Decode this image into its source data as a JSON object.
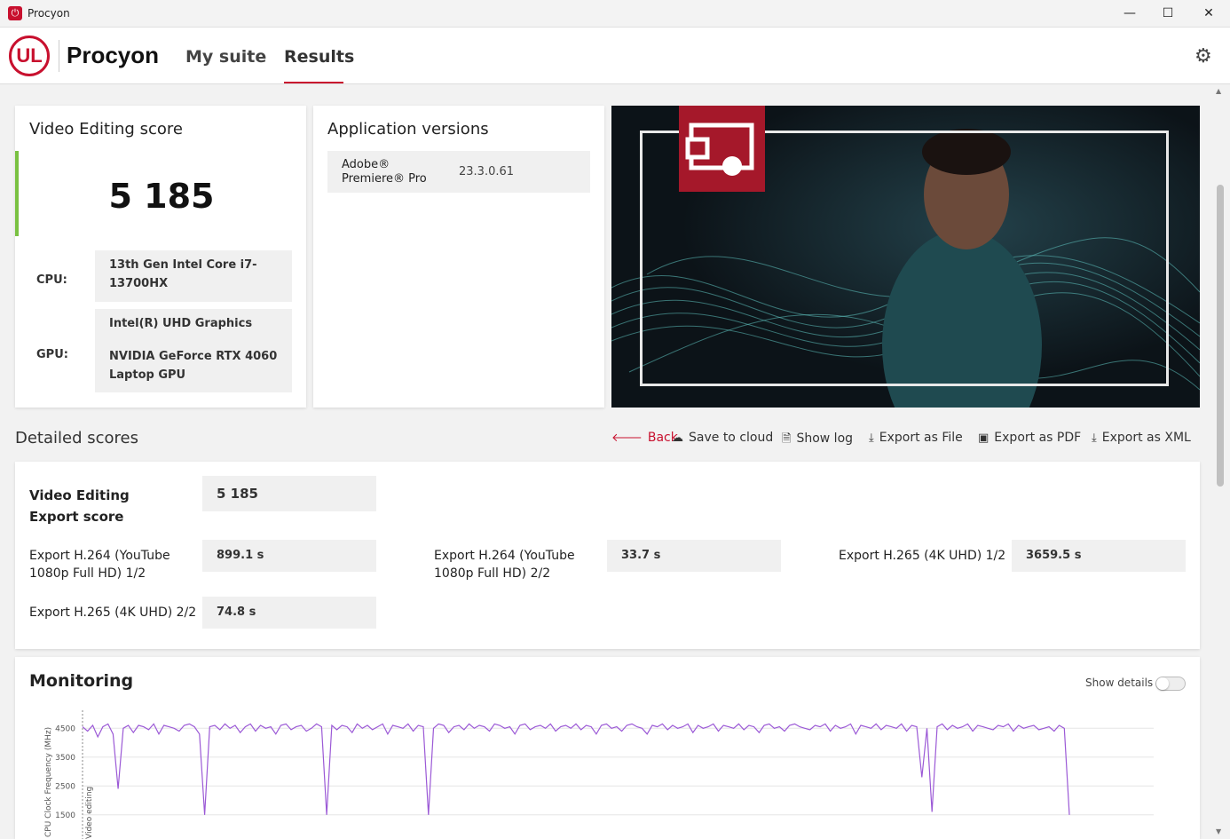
{
  "window": {
    "title": "Procyon",
    "minimize": "—",
    "maximize": "☐",
    "close": "✕"
  },
  "header": {
    "logo": "UL",
    "brand": "Procyon",
    "nav": [
      {
        "label": "My suite",
        "active": false
      },
      {
        "label": "Results",
        "active": true
      }
    ],
    "settings_icon": "gear-icon"
  },
  "score_card": {
    "title": "Video Editing score",
    "score": "5 185",
    "accent_color": "#7ac142",
    "cpu_label": "CPU:",
    "cpu_value": "13th Gen Intel Core i7-13700HX",
    "gpu_label": "GPU:",
    "gpu_value_1": "Intel(R) UHD Graphics",
    "gpu_value_2": "NVIDIA GeForce RTX 4060 Laptop GPU"
  },
  "app_versions": {
    "title": "Application versions",
    "rows": [
      {
        "name": "Adobe® Premiere® Pro",
        "version": "23.3.0.61"
      }
    ]
  },
  "detailed": {
    "title": "Detailed scores",
    "actions": [
      {
        "label": "Back",
        "icon": "arrow-left-icon"
      },
      {
        "label": "Save to cloud",
        "icon": "cloud-upload-icon"
      },
      {
        "label": "Show log",
        "icon": "document-icon"
      },
      {
        "label": "Export as File",
        "icon": "download-icon"
      },
      {
        "label": "Export as PDF",
        "icon": "save-icon"
      },
      {
        "label": "Export as XML",
        "icon": "download-icon"
      }
    ],
    "main_label": "Video Editing Export score",
    "main_value": "5 185",
    "subscores": [
      {
        "label": "Export H.264 (YouTube 1080p Full HD) 1/2",
        "value": "899.1 s"
      },
      {
        "label": "Export H.264 (YouTube 1080p Full HD) 2/2",
        "value": "33.7 s"
      },
      {
        "label": "Export H.265 (4K UHD) 1/2",
        "value": "3659.5 s"
      },
      {
        "label": "Export H.265 (4K UHD) 2/2",
        "value": "74.8 s"
      }
    ]
  },
  "monitoring": {
    "title": "Monitoring",
    "show_details_label": "Show details",
    "show_details_on": false
  },
  "chart_data": {
    "type": "line",
    "ylabel": "CPU Clock Frequency (MHz)",
    "y_ticks": [
      "4500",
      "3500",
      "2500",
      "1500"
    ],
    "ylim": [
      1000,
      5000
    ],
    "marker_label": "Video editing",
    "series_color": "#9b59d6",
    "series": [
      {
        "values": [
          4550,
          4400,
          4600,
          4200,
          4550,
          4650,
          4300,
          2400,
          4500,
          4600,
          4350,
          4600,
          4550,
          4450,
          4650,
          4300,
          4600,
          4550,
          4500,
          4400,
          4600,
          4650,
          4550,
          4300,
          1500,
          4550,
          4600,
          4450,
          4650,
          4500,
          4600,
          4350,
          4550,
          4650,
          4400,
          4600,
          4500,
          4550,
          4300,
          4600,
          4650,
          4450,
          4550,
          4600,
          4400,
          4500,
          4650,
          4550,
          1500,
          4600,
          4450,
          4600,
          4550,
          4350,
          4650,
          4500,
          4600,
          4450,
          4550,
          4650,
          4300,
          4600,
          4550,
          4500,
          4650,
          4400,
          4600,
          4550,
          1500,
          4500,
          4650,
          4600,
          4350,
          4550,
          4600,
          4450,
          4650,
          4500,
          4600,
          4550,
          4400,
          4650,
          4600,
          4500,
          4550,
          4300,
          4600,
          4650,
          4450,
          4550,
          4600,
          4500,
          4650,
          4400,
          4550,
          4600,
          4500,
          4650,
          4450,
          4600,
          4550,
          4300,
          4600,
          4650,
          4500,
          4550,
          4400,
          4600,
          4650,
          4550,
          4500,
          4300,
          4600,
          4550,
          4650,
          4450,
          4600,
          4500,
          4550,
          4650,
          4350,
          4600,
          4500,
          4550,
          4650,
          4400,
          4600,
          4550,
          4500,
          4650,
          4450,
          4600,
          4550,
          4350,
          4600,
          4650,
          4500,
          4550,
          4400,
          4600,
          4650,
          4550,
          4500,
          4450,
          4600,
          4550,
          4650,
          4400,
          4600,
          4500,
          4550,
          4650,
          4300,
          4600,
          4550,
          4500,
          4650,
          4450,
          4600,
          4550,
          4500,
          4650,
          4400,
          4600,
          4550,
          2800,
          4500,
          1600,
          4550,
          4650,
          4450,
          4600,
          4500,
          4550,
          4650,
          4400,
          4600,
          4550,
          4500,
          4450,
          4600,
          4550,
          4650,
          4400,
          4600,
          4500,
          4550,
          4600,
          4450,
          4500,
          4550,
          4400,
          4600,
          4500,
          1500
        ]
      }
    ]
  }
}
